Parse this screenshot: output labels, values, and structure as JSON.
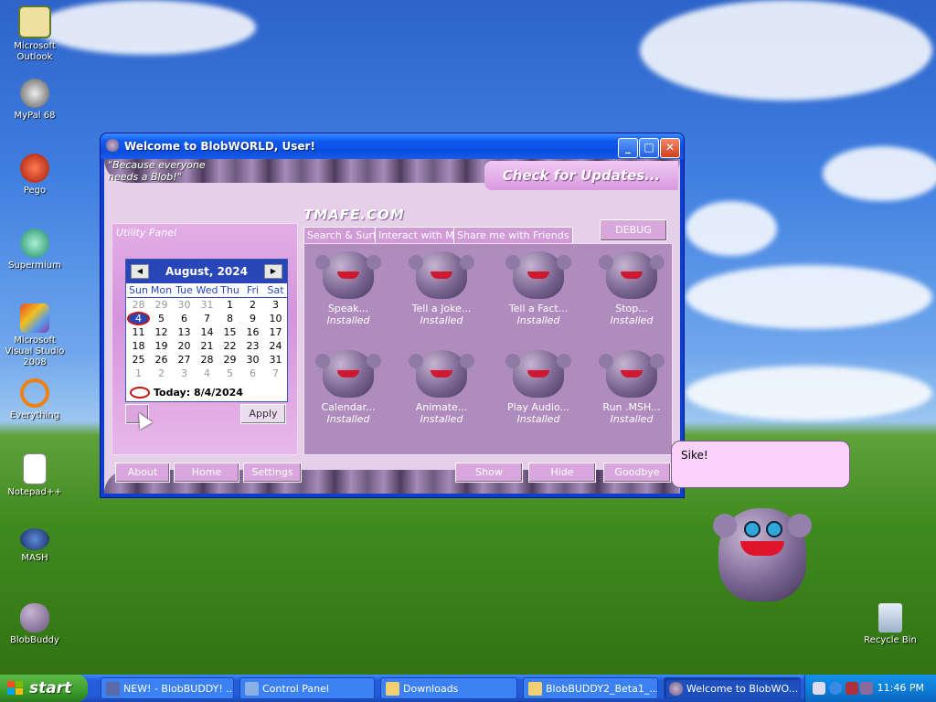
{
  "desktop": {
    "icons": [
      {
        "label": "Microsoft Outlook",
        "icon": "outlook-icon"
      },
      {
        "label": "MyPal 68",
        "icon": "raccoon-icon"
      },
      {
        "label": "Pego",
        "icon": "pego-icon"
      },
      {
        "label": "Supermium",
        "icon": "supermium-icon"
      },
      {
        "label": "Microsoft Visual Studio 2008",
        "icon": "visual-studio-icon"
      },
      {
        "label": "Everything",
        "icon": "everything-icon"
      },
      {
        "label": "Notepad++",
        "icon": "notepadpp-icon"
      },
      {
        "label": "MASH",
        "icon": "mash-icon"
      },
      {
        "label": "BlobBuddy",
        "icon": "blob-icon"
      },
      {
        "label": "Recycle Bin",
        "icon": "recycle-bin-icon"
      }
    ]
  },
  "window": {
    "title": "Welcome to BlobWORLD, User!",
    "slogan_line1": "\"Because everyone",
    "slogan_line2": "needs a Blob!\"",
    "updates_label": "Check for Updates...",
    "watermark": "TMAFE.COM",
    "debug_label": "DEBUG",
    "utility_panel": {
      "title": "Utility Panel",
      "calendar": {
        "month_year": "August, 2024",
        "days_of_week": [
          "Sun",
          "Mon",
          "Tue",
          "Wed",
          "Thu",
          "Fri",
          "Sat"
        ],
        "weeks": [
          [
            "28",
            "29",
            "30",
            "31",
            "1",
            "2",
            "3"
          ],
          [
            "4",
            "5",
            "6",
            "7",
            "8",
            "9",
            "10"
          ],
          [
            "11",
            "12",
            "13",
            "14",
            "15",
            "16",
            "17"
          ],
          [
            "18",
            "19",
            "20",
            "21",
            "22",
            "23",
            "24"
          ],
          [
            "25",
            "26",
            "27",
            "28",
            "29",
            "30",
            "31"
          ],
          [
            "1",
            "2",
            "3",
            "4",
            "5",
            "6",
            "7"
          ]
        ],
        "today_label": "Today: 8/4/2024"
      },
      "apply_label": "Apply"
    },
    "tabs": [
      "Search & Surf",
      "Interact with Me",
      "Share me with Friends"
    ],
    "actions": [
      {
        "label": "Speak...",
        "status": "Installed"
      },
      {
        "label": "Tell a Joke...",
        "status": "Installed"
      },
      {
        "label": "Tell a Fact...",
        "status": "Installed"
      },
      {
        "label": "Stop...",
        "status": "Installed"
      },
      {
        "label": "Calendar...",
        "status": "Installed"
      },
      {
        "label": "Animate...",
        "status": "Installed"
      },
      {
        "label": "Play Audio...",
        "status": "Installed"
      },
      {
        "label": "Run .MSH...",
        "status": "Installed"
      }
    ],
    "bottom_left_buttons": [
      "About",
      "Home",
      "Settings"
    ],
    "bottom_right_buttons": [
      "Show",
      "Hide",
      "Goodbye"
    ]
  },
  "speech_bubble": "Sike!",
  "taskbar": {
    "start_label": "start",
    "tasks": [
      {
        "label": "NEW! - BlobBUDDY! ..."
      },
      {
        "label": "Control Panel"
      },
      {
        "label": "Downloads"
      },
      {
        "label": "BlobBUDDY2_Beta1_..."
      },
      {
        "label": "Welcome to BlobWO..."
      }
    ],
    "clock": "11:46 PM"
  }
}
